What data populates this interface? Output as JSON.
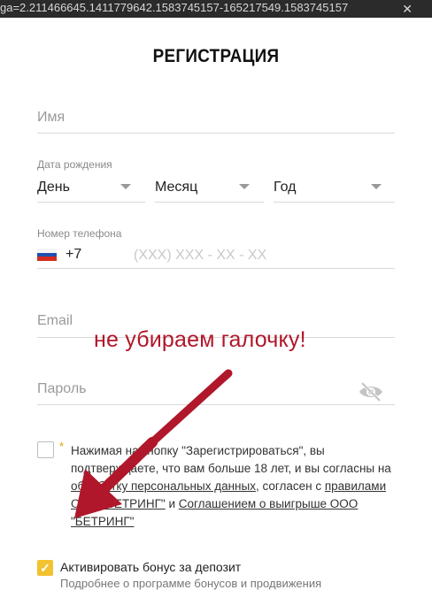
{
  "browser": {
    "url_fragment": "ga=2.211466645.1411779642.1583745157-165217549.1583745157"
  },
  "form": {
    "title": "РЕГИСТРАЦИЯ",
    "name_placeholder": "Имя",
    "birthdate_label": "Дата рождения",
    "day": "День",
    "month": "Месяц",
    "year": "Год",
    "phone_label": "Номер телефона",
    "phone_code": "+7",
    "phone_placeholder": "(XXX) XXX - XX - XX",
    "email_placeholder": "Email",
    "password_placeholder": "Пароль",
    "required_mark": "*",
    "consent": {
      "part1": "Нажимая на кнопку \"Зарегистрироваться\", вы подтверждаете, что вам больше 18 лет, и вы согласны на ",
      "link1": "обработку персональных данных",
      "part2": ", согласен с ",
      "link2": "правилами ООО \"БЕТРИНГ\"",
      "part3": " и ",
      "link3": "Соглашением о выигрыше ООО \"БЕТРИНГ\""
    },
    "bonus_label": "Активировать бонус за депозит",
    "bonus_sub": "Подробнее о программе бонусов и продвижения"
  },
  "annotation": {
    "text": "не убираем галочку!",
    "color": "#b0172a"
  },
  "colors": {
    "accent": "#f2c230",
    "required": "#e3a300"
  }
}
